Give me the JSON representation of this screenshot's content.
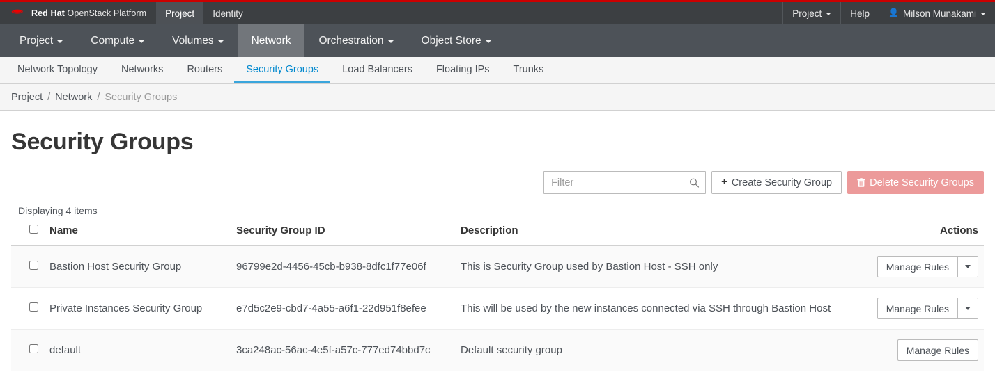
{
  "masthead": {
    "brand_bold": "Red Hat",
    "brand_rest": "OpenStack Platform",
    "nav": [
      {
        "label": "Project",
        "active": true
      },
      {
        "label": "Identity",
        "active": false
      }
    ],
    "right": {
      "project_label": "Project",
      "help_label": "Help",
      "user_label": "Milson Munakami"
    }
  },
  "primary_nav": [
    {
      "label": "Project",
      "caret": true,
      "active": false
    },
    {
      "label": "Compute",
      "caret": true,
      "active": false
    },
    {
      "label": "Volumes",
      "caret": true,
      "active": false
    },
    {
      "label": "Network",
      "caret": false,
      "active": true
    },
    {
      "label": "Orchestration",
      "caret": true,
      "active": false
    },
    {
      "label": "Object Store",
      "caret": true,
      "active": false
    }
  ],
  "secondary_nav": [
    {
      "label": "Network Topology",
      "active": false
    },
    {
      "label": "Networks",
      "active": false
    },
    {
      "label": "Routers",
      "active": false
    },
    {
      "label": "Security Groups",
      "active": true
    },
    {
      "label": "Load Balancers",
      "active": false
    },
    {
      "label": "Floating IPs",
      "active": false
    },
    {
      "label": "Trunks",
      "active": false
    }
  ],
  "breadcrumb": {
    "items": [
      "Project",
      "Network",
      "Security Groups"
    ],
    "separator": "/"
  },
  "page": {
    "title": "Security Groups",
    "count_text": "Displaying 4 items"
  },
  "toolbar": {
    "filter_placeholder": "Filter",
    "filter_value": "",
    "create_label": "Create Security Group",
    "create_icon": "plus-icon",
    "delete_label": "Delete Security Groups",
    "delete_icon": "trash-icon",
    "search_icon": "search-icon"
  },
  "table": {
    "columns": [
      "Name",
      "Security Group ID",
      "Description",
      "Actions"
    ],
    "rows": [
      {
        "name": "Bastion Host Security Group",
        "id": "96799e2d-4456-45cb-b938-8dfc1f77e06f",
        "description": "This is Security Group used by Bastion Host - SSH only",
        "action_label": "Manage Rules",
        "has_dropdown": true,
        "selected": false
      },
      {
        "name": "Private Instances Security Group",
        "id": "e7d5c2e9-cbd7-4a55-a6f1-22d951f8efee",
        "description": "This will be used by the new instances connected via SSH through Bastion Host",
        "action_label": "Manage Rules",
        "has_dropdown": true,
        "selected": false
      },
      {
        "name": "default",
        "id": "3ca248ac-56ac-4e5f-a57c-777ed74bbd7c",
        "description": "Default security group",
        "action_label": "Manage Rules",
        "has_dropdown": false,
        "selected": false
      }
    ]
  },
  "colors": {
    "accent_red": "#cc0000",
    "masthead_bg": "#3c3f42",
    "primary_nav_bg": "#4d5258",
    "active_tab_blue": "#0088ce",
    "tab_underline": "#39a5dc",
    "danger_bg": "#ec9a9a"
  }
}
